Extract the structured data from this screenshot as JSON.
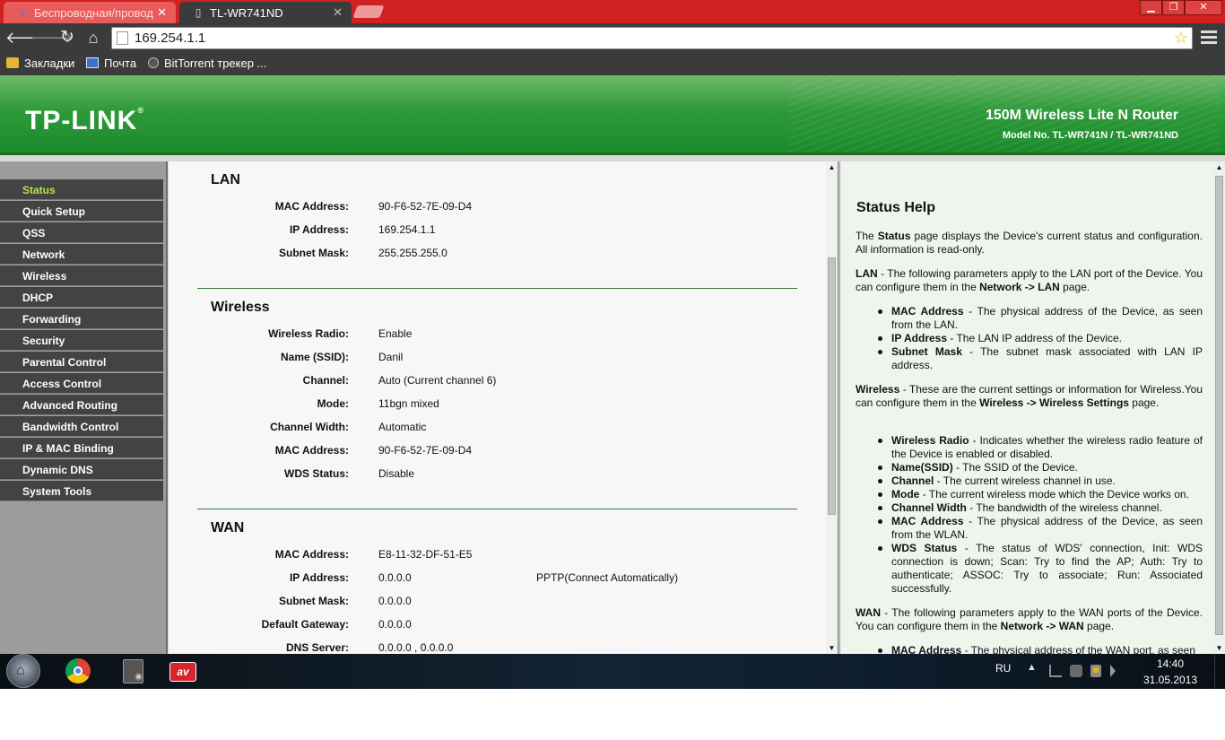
{
  "browser": {
    "tabs": [
      {
        "label": "Беспроводная/провод",
        "active": false
      },
      {
        "label": "TL-WR741ND",
        "active": true
      }
    ],
    "window_buttons": {
      "minimize": "▁",
      "maximize": "❐",
      "close": "✕"
    },
    "url": "169.254.1.1",
    "bookmarks": [
      {
        "label": "Закладки",
        "icon": "folder-icon"
      },
      {
        "label": "Почта",
        "icon": "mail-icon"
      },
      {
        "label": "BitTorrent трекер ...",
        "icon": "bittorrent-icon"
      }
    ]
  },
  "router": {
    "brand": "TP-LINK",
    "product_name": "150M Wireless Lite N Router",
    "model_no": "Model No. TL-WR741N / TL-WR741ND",
    "menu": [
      {
        "label": "Status",
        "active": true
      },
      {
        "label": "Quick Setup"
      },
      {
        "label": "QSS"
      },
      {
        "label": "Network"
      },
      {
        "label": "Wireless"
      },
      {
        "label": "DHCP"
      },
      {
        "label": "Forwarding"
      },
      {
        "label": "Security"
      },
      {
        "label": "Parental Control"
      },
      {
        "label": "Access Control"
      },
      {
        "label": "Advanced Routing"
      },
      {
        "label": "Bandwidth Control"
      },
      {
        "label": "IP & MAC Binding"
      },
      {
        "label": "Dynamic DNS"
      },
      {
        "label": "System Tools"
      }
    ],
    "status": {
      "lan": {
        "title": "LAN",
        "mac_label": "MAC Address:",
        "mac": "90-F6-52-7E-09-D4",
        "ip_label": "IP Address:",
        "ip": "169.254.1.1",
        "mask_label": "Subnet Mask:",
        "mask": "255.255.255.0"
      },
      "wireless": {
        "title": "Wireless",
        "radio_label": "Wireless Radio:",
        "radio": "Enable",
        "ssid_label": "Name (SSID):",
        "ssid": "Danil",
        "channel_label": "Channel:",
        "channel": "Auto (Current channel 6)",
        "mode_label": "Mode:",
        "mode": "11bgn mixed",
        "width_label": "Channel Width:",
        "width": "Automatic",
        "mac_label": "MAC Address:",
        "mac": "90-F6-52-7E-09-D4",
        "wds_label": "WDS Status:",
        "wds": "Disable"
      },
      "wan": {
        "title": "WAN",
        "mac_label": "MAC Address:",
        "mac": "E8-11-32-DF-51-E5",
        "ip_label": "IP Address:",
        "ip": "0.0.0.0",
        "conn_type": "PPTP(Connect Automatically)",
        "mask_label": "Subnet Mask:",
        "mask": "0.0.0.0",
        "gateway_label": "Default Gateway:",
        "gateway": "0.0.0.0",
        "dns_label": "DNS Server:",
        "dns": "0.0.0.0 , 0.0.0.0"
      }
    },
    "help": {
      "title": "Status Help",
      "intro_1": "The",
      "intro_bold": "Status",
      "intro_2": "page displays the Device's current status and configuration. All information is read-only.",
      "lan_bold": "LAN",
      "lan_1": " - The following parameters apply to the LAN port of the Device. You can configure them in the ",
      "lan_path": "Network -> LAN",
      "lan_2": " page.",
      "lan_items": [
        {
          "term": "MAC Address",
          "desc": " - The physical address of the Device, as seen from the LAN."
        },
        {
          "term": "IP Address",
          "desc": " - The LAN IP address of the Device."
        },
        {
          "term": "Subnet Mask",
          "desc": " - The subnet mask associated with LAN IP address."
        }
      ],
      "wireless_bold": "Wireless",
      "wireless_1": " - These are the current settings or information for Wireless.You can configure them in the ",
      "wireless_path": "Wireless -> Wireless Settings",
      "wireless_2": " page.",
      "wireless_items": [
        {
          "term": "Wireless Radio",
          "desc": " - Indicates whether the wireless radio feature of the Device is enabled or disabled."
        },
        {
          "term": "Name(SSID)",
          "desc": " - The SSID of the Device."
        },
        {
          "term": "Channel",
          "desc": " - The current wireless channel in use."
        },
        {
          "term": "Mode",
          "desc": " - The current wireless mode which the Device works on."
        },
        {
          "term": "Channel Width",
          "desc": " - The bandwidth of the wireless channel."
        },
        {
          "term": "MAC Address",
          "desc": " - The physical address of the Device, as seen from the WLAN."
        },
        {
          "term": "WDS Status",
          "desc": " - The status of WDS' connection, Init: WDS connection is down; Scan: Try to find the AP; Auth: Try to authenticate; ASSOC: Try to associate; Run: Associated successfully."
        }
      ],
      "wan_bold": "WAN",
      "wan_1": " - The following parameters apply to the WAN ports of the Device. You can configure them in the ",
      "wan_path": "Network -> WAN",
      "wan_2": " page.",
      "wan_items": [
        {
          "term": "MAC Address",
          "desc": " - The physical address of the WAN port, as seen"
        }
      ]
    }
  },
  "taskbar": {
    "language": "RU",
    "time": "14:40",
    "date": "31.05.2013",
    "av_label": "av"
  }
}
